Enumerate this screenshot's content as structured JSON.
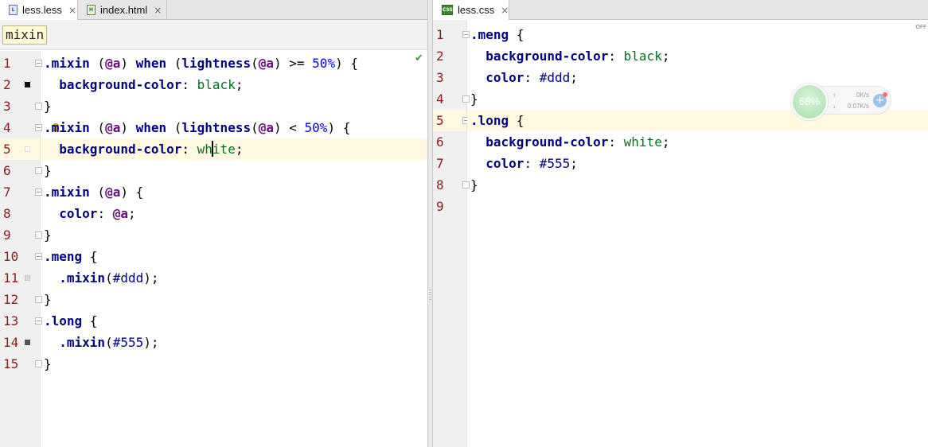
{
  "left_editor": {
    "tabs": [
      {
        "label": "less.less",
        "icon": "less-file-icon",
        "close": "×"
      },
      {
        "label": "index.html",
        "icon": "html-file-icon",
        "close": "×"
      }
    ],
    "breadcrumb": "mixin",
    "lines": [
      {
        "n": "1",
        "tokens": [
          [
            "sel",
            ".mixin"
          ],
          [
            "pun",
            " ("
          ],
          [
            "var",
            "@a"
          ],
          [
            "pun",
            ") "
          ],
          [
            "kw",
            "when"
          ],
          [
            "pun",
            " ("
          ],
          [
            "kw",
            "lightness"
          ],
          [
            "pun",
            "("
          ],
          [
            "var",
            "@a"
          ],
          [
            "pun",
            ") >= "
          ],
          [
            "num",
            "50%"
          ],
          [
            "pun",
            ") {"
          ]
        ]
      },
      {
        "n": "2",
        "tokens": [
          [
            "pun",
            "  "
          ],
          [
            "prop",
            "background-color"
          ],
          [
            "pun",
            ": "
          ],
          [
            "val",
            "black"
          ],
          [
            "pun",
            ";"
          ]
        ]
      },
      {
        "n": "3",
        "tokens": [
          [
            "pun",
            "}"
          ]
        ]
      },
      {
        "n": "4",
        "tokens": [
          [
            "sel",
            ".mixin"
          ],
          [
            "pun",
            " ("
          ],
          [
            "var",
            "@a"
          ],
          [
            "pun",
            ") "
          ],
          [
            "kw",
            "when"
          ],
          [
            "pun",
            " ("
          ],
          [
            "kw",
            "lightness"
          ],
          [
            "pun",
            "("
          ],
          [
            "var",
            "@a"
          ],
          [
            "pun",
            ") < "
          ],
          [
            "num",
            "50%"
          ],
          [
            "pun",
            ") {"
          ]
        ]
      },
      {
        "n": "5",
        "tokens": [
          [
            "pun",
            "  "
          ],
          [
            "prop",
            "background-color"
          ],
          [
            "pun",
            ": "
          ],
          [
            "val",
            "wh"
          ],
          [
            "caret",
            ""
          ],
          [
            "val",
            "ite"
          ],
          [
            "pun",
            ";"
          ]
        ]
      },
      {
        "n": "6",
        "tokens": [
          [
            "pun",
            "}"
          ]
        ]
      },
      {
        "n": "7",
        "tokens": [
          [
            "sel",
            ".mixin"
          ],
          [
            "pun",
            " ("
          ],
          [
            "var",
            "@a"
          ],
          [
            "pun",
            ") {"
          ]
        ]
      },
      {
        "n": "8",
        "tokens": [
          [
            "pun",
            "  "
          ],
          [
            "prop",
            "color"
          ],
          [
            "pun",
            ": "
          ],
          [
            "var",
            "@a"
          ],
          [
            "pun",
            ";"
          ]
        ]
      },
      {
        "n": "9",
        "tokens": [
          [
            "pun",
            "}"
          ]
        ]
      },
      {
        "n": "10",
        "tokens": [
          [
            "sel",
            ".meng"
          ],
          [
            "pun",
            " {"
          ]
        ]
      },
      {
        "n": "11",
        "tokens": [
          [
            "pun",
            "  "
          ],
          [
            "sel",
            ".mixin"
          ],
          [
            "pun",
            "("
          ],
          [
            "hex",
            "#ddd"
          ],
          [
            "pun",
            ");"
          ]
        ]
      },
      {
        "n": "12",
        "tokens": [
          [
            "pun",
            "}"
          ]
        ]
      },
      {
        "n": "13",
        "tokens": [
          [
            "sel",
            ".long"
          ],
          [
            "pun",
            " {"
          ]
        ]
      },
      {
        "n": "14",
        "tokens": [
          [
            "pun",
            "  "
          ],
          [
            "sel",
            ".mixin"
          ],
          [
            "pun",
            "("
          ],
          [
            "hex",
            "#555"
          ],
          [
            "pun",
            ");"
          ]
        ]
      },
      {
        "n": "15",
        "tokens": [
          [
            "pun",
            "}"
          ]
        ]
      }
    ],
    "current_line": 5
  },
  "right_editor": {
    "tabs": [
      {
        "label": "less.css",
        "icon": "css-file-icon",
        "close": "×"
      }
    ],
    "off_label": "OFF",
    "lines": [
      {
        "n": "1",
        "tokens": [
          [
            "sel",
            ".meng"
          ],
          [
            "pun",
            " {"
          ]
        ]
      },
      {
        "n": "2",
        "tokens": [
          [
            "pun",
            "  "
          ],
          [
            "prop",
            "background-color"
          ],
          [
            "pun",
            ": "
          ],
          [
            "val",
            "black"
          ],
          [
            "pun",
            ";"
          ]
        ]
      },
      {
        "n": "3",
        "tokens": [
          [
            "pun",
            "  "
          ],
          [
            "prop",
            "color"
          ],
          [
            "pun",
            ": "
          ],
          [
            "hex",
            "#ddd"
          ],
          [
            "pun",
            ";"
          ]
        ]
      },
      {
        "n": "4",
        "tokens": [
          [
            "pun",
            "}"
          ]
        ]
      },
      {
        "n": "5",
        "tokens": [
          [
            "sel",
            ".long"
          ],
          [
            "pun",
            " {"
          ]
        ]
      },
      {
        "n": "6",
        "tokens": [
          [
            "pun",
            "  "
          ],
          [
            "prop",
            "background-color"
          ],
          [
            "pun",
            ": "
          ],
          [
            "val",
            "white"
          ],
          [
            "pun",
            ";"
          ]
        ]
      },
      {
        "n": "7",
        "tokens": [
          [
            "pun",
            "  "
          ],
          [
            "prop",
            "color"
          ],
          [
            "pun",
            ": "
          ],
          [
            "hex",
            "#555"
          ],
          [
            "pun",
            ";"
          ]
        ]
      },
      {
        "n": "8",
        "tokens": [
          [
            "pun",
            "}"
          ]
        ]
      },
      {
        "n": "9",
        "tokens": []
      }
    ],
    "current_line": 5
  },
  "net_widget": {
    "percent": "68%",
    "upload_arrow": "↑",
    "upload": "0K/s",
    "download_arrow": "↓",
    "download": "0.07K/s",
    "plus": "+"
  },
  "colors": {
    "line_number": "#8a1c1c",
    "selector": "#000080",
    "value": "#007020",
    "variable": "#660e7a",
    "number": "#0000ff",
    "current_line_bg": "#fff9e2"
  }
}
